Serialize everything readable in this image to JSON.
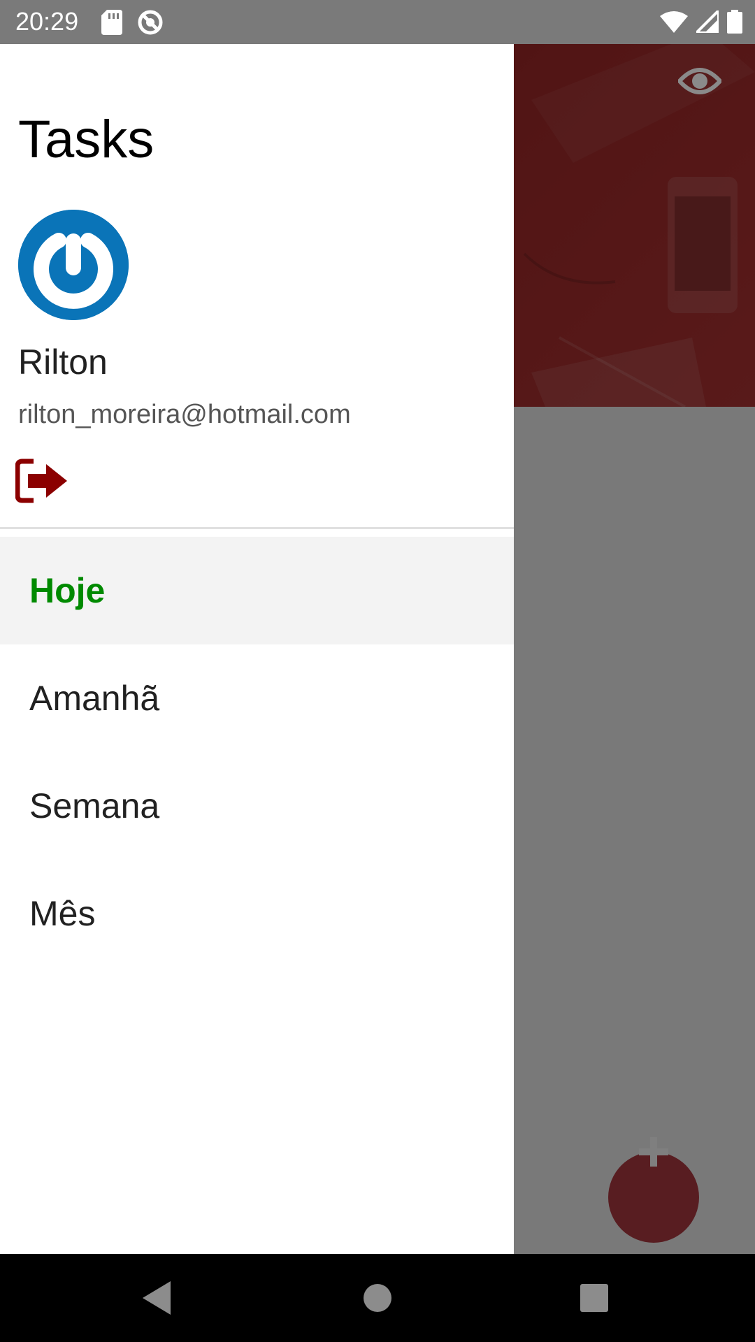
{
  "status_bar": {
    "time": "20:29",
    "left_icons": [
      "sd-card-icon",
      "do-not-disturb-icon"
    ],
    "right_icons": [
      "wifi-icon",
      "signal-icon",
      "battery-icon"
    ]
  },
  "drawer": {
    "title": "Tasks",
    "user": {
      "name": "Rilton",
      "email": "rilton_moreira@hotmail.com",
      "avatar_icon": "power-logo-icon"
    },
    "logout_icon": "sign-out-icon",
    "menu": [
      {
        "label": "Hoje",
        "active": true
      },
      {
        "label": "Amanhã",
        "active": false
      },
      {
        "label": "Semana",
        "active": false
      },
      {
        "label": "Mês",
        "active": false
      }
    ]
  },
  "background_app": {
    "toggle_icon": "eye-icon",
    "fab_icon": "plus-icon"
  },
  "colors": {
    "accent": "#8b0000",
    "active_menu_text": "#008a00",
    "fab": "#b03a42",
    "avatar": "#0a74b8"
  },
  "nav_bar": {
    "buttons": [
      "back-icon",
      "home-icon",
      "recents-icon"
    ]
  }
}
